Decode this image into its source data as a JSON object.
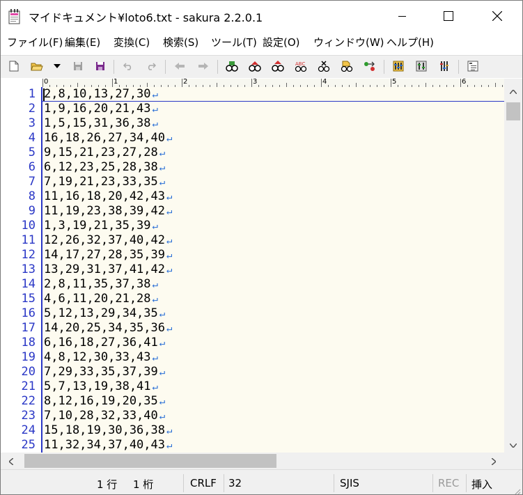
{
  "window": {
    "title": "マイドキュメント¥loto6.txt - sakura 2.2.0.1",
    "app_icon": "notepad-icon"
  },
  "menu": [
    {
      "label": "ファイル(F)"
    },
    {
      "label": "編集(E)"
    },
    {
      "label": "変換(C)"
    },
    {
      "label": "検索(S)"
    },
    {
      "label": "ツール(T)"
    },
    {
      "label": "設定(O)"
    },
    {
      "label": "ウィンドウ(W)"
    },
    {
      "label": "ヘルプ(H)"
    }
  ],
  "toolbar": [
    "new-file-icon",
    "open-folder-icon",
    "dropdown-arrow-icon",
    "save-icon",
    "save-all-icon",
    "undo-icon",
    "redo-icon",
    "jump-back-icon",
    "jump-forward-icon",
    "search-icon",
    "search-next-icon",
    "search-prev-icon",
    "replace-icon",
    "clear-search-icon",
    "grep-icon",
    "jump-tag-icon",
    "settings-icon",
    "type-settings-icon",
    "common-settings-icon",
    "outline-icon"
  ],
  "ruler": {
    "labels": [
      "0",
      "1",
      "2",
      "3",
      "4",
      "5",
      "6"
    ]
  },
  "editor": {
    "line_numbers": [
      "1",
      "2",
      "3",
      "4",
      "5",
      "6",
      "7",
      "8",
      "9",
      "10",
      "11",
      "12",
      "13",
      "14",
      "15",
      "16",
      "17",
      "18",
      "19",
      "20",
      "21",
      "22",
      "23",
      "24",
      "25"
    ],
    "lines": [
      "2,8,10,13,27,30",
      "1,9,16,20,21,43",
      "1,5,15,31,36,38",
      "16,18,26,27,34,40",
      "9,15,21,23,27,28",
      "6,12,23,25,28,38",
      "7,19,21,23,33,35",
      "11,16,18,20,42,43",
      "11,19,23,38,39,42",
      "1,3,19,21,35,39",
      "12,26,32,37,40,42",
      "14,17,27,28,35,39",
      "13,29,31,37,41,42",
      "2,8,11,35,37,38",
      "4,6,11,20,21,28",
      "5,12,13,29,34,35",
      "14,20,25,34,35,36",
      "6,16,18,27,36,41",
      "4,8,12,30,33,43",
      "7,29,33,35,37,39",
      "5,7,13,19,38,41",
      "8,12,16,19,20,35",
      "7,10,28,32,33,40",
      "15,18,19,30,36,38",
      "11,32,34,37,40,43"
    ],
    "eol_mark": "↵"
  },
  "status": {
    "line": "1 行",
    "column": "1 桁",
    "newline": "CRLF",
    "char_code": "32",
    "encoding": "SJIS",
    "rec": "REC",
    "insert_mode": "挿入"
  },
  "colors": {
    "line_number": "#2a37c6",
    "eol": "#2a6fd6",
    "background": "#fdfbf0"
  }
}
